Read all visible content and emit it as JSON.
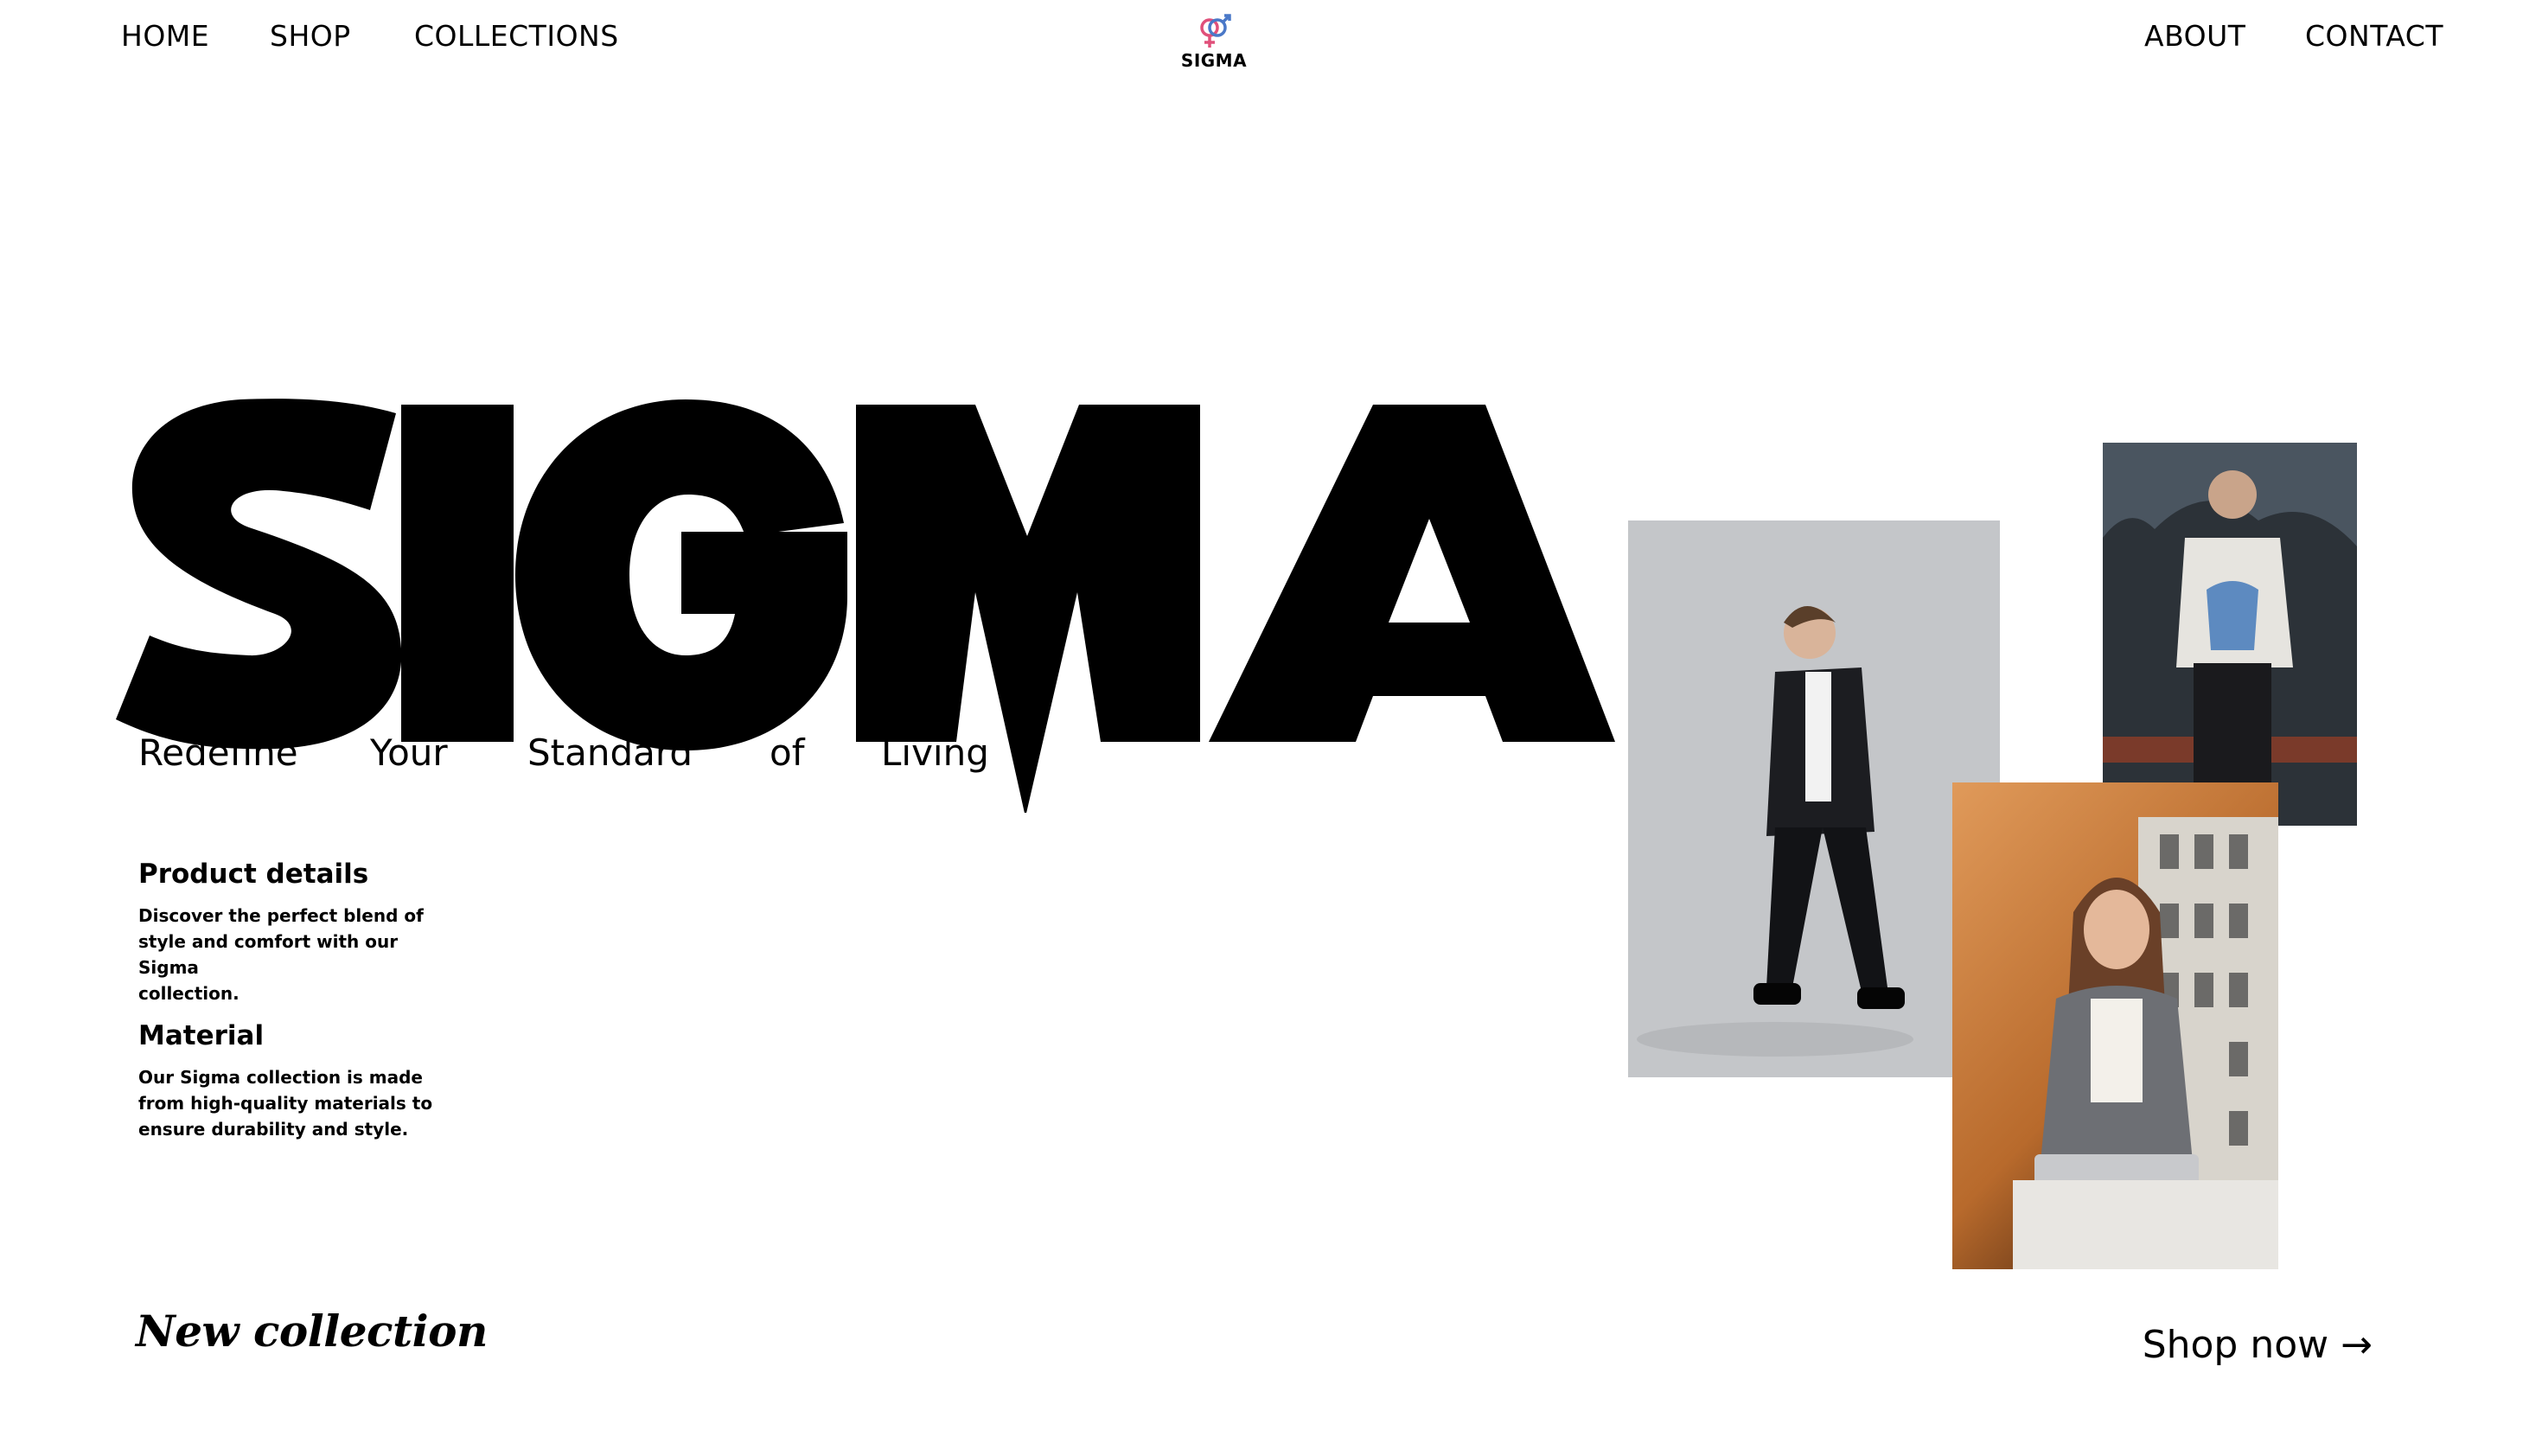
{
  "nav": {
    "left": [
      "HOME",
      "SHOP",
      "COLLECTIONS"
    ],
    "right": [
      "ABOUT",
      "CONTACT"
    ]
  },
  "logo": {
    "text": "SIGMA",
    "icon": "gender-symbols-icon",
    "colors": {
      "female": "#e0507a",
      "male": "#4a78c8"
    }
  },
  "hero": {
    "word": "SIGMA",
    "tagline": [
      "Redefine",
      "Your",
      "Standard",
      "of",
      "Living"
    ]
  },
  "details": [
    {
      "title": "Product details",
      "lines": [
        "Discover the perfect blend of",
        "style and comfort with our Sigma",
        "collection."
      ]
    },
    {
      "title": "Material",
      "lines": [
        "Our Sigma collection is made",
        "from high-quality materials to",
        "ensure durability and style."
      ]
    }
  ],
  "footer": {
    "new_collection": "New collection",
    "shop_now": "Shop now →"
  },
  "photos": [
    {
      "name": "man-in-suit-photo",
      "bg": "#c4c6c9"
    },
    {
      "name": "man-in-sweater-photo",
      "bg": "#2c3238"
    },
    {
      "name": "woman-in-blazer-photo",
      "bg": "#c0783a"
    }
  ]
}
